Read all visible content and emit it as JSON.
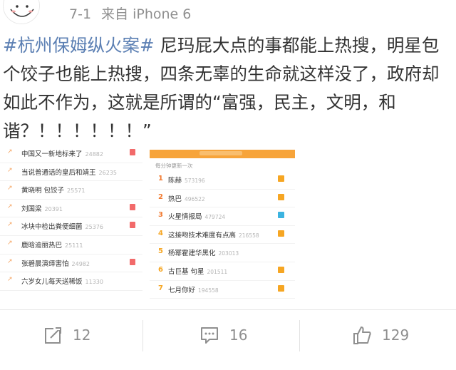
{
  "header": {
    "date": "7-1",
    "source": "来自 iPhone 6"
  },
  "post": {
    "topic": "#杭州保姆纵火案#",
    "body": " 尼玛屁大点的事都能上热搜，明星包个饺子也能上热搜，四条无辜的生命就这样没了，政府却如此不作为，这就是所谓的“富强，民主，文明，和谐？！！！！！！”"
  },
  "screenshot_left": {
    "items": [
      {
        "title": "中国又一新地标来了",
        "count": "24882",
        "tag": true
      },
      {
        "title": "当说普通话的皇后和靖王",
        "count": "26235",
        "tag": false
      },
      {
        "title": "黄晓明 包饺子",
        "count": "25571",
        "tag": false
      },
      {
        "title": "刘国梁",
        "count": "20391",
        "tag": true
      },
      {
        "title": "冰块中检出粪便细菌",
        "count": "25376",
        "tag": true
      },
      {
        "title": "鹿晗迪丽热巴",
        "count": "25111",
        "tag": false
      },
      {
        "title": "张碧晨演绎害怕",
        "count": "24982",
        "tag": true
      },
      {
        "title": "六岁女儿每天送稀饭",
        "count": "11330",
        "tag": false
      }
    ]
  },
  "screenshot_right": {
    "subtitle": "每分钟更新一次",
    "items": [
      {
        "rank": "1",
        "title": "陈赫",
        "count": "573196",
        "tag_color": "#f6a623"
      },
      {
        "rank": "2",
        "title": "热巴",
        "count": "496522",
        "tag_color": "#f6a623"
      },
      {
        "rank": "3",
        "title": "火星情报局",
        "count": "479724",
        "tag_color": "#3bb3e0"
      },
      {
        "rank": "4",
        "title": "这接吻技术难度有点高",
        "count": "216558",
        "tag_color": "#f6a623"
      },
      {
        "rank": "5",
        "title": "杨幂霍建华黑化",
        "count": "203013",
        "tag_color": ""
      },
      {
        "rank": "6",
        "title": "古巨基 句星",
        "count": "201511",
        "tag_color": "#f6a623"
      },
      {
        "rank": "7",
        "title": "七月你好",
        "count": "194558",
        "tag_color": "#f6a623"
      }
    ]
  },
  "actions": {
    "repost_count": "12",
    "comment_count": "16",
    "like_count": "129"
  },
  "colors": {
    "topic": "#5b7fb3",
    "accent": "#f7a43a",
    "meta": "#8f8f8f"
  }
}
